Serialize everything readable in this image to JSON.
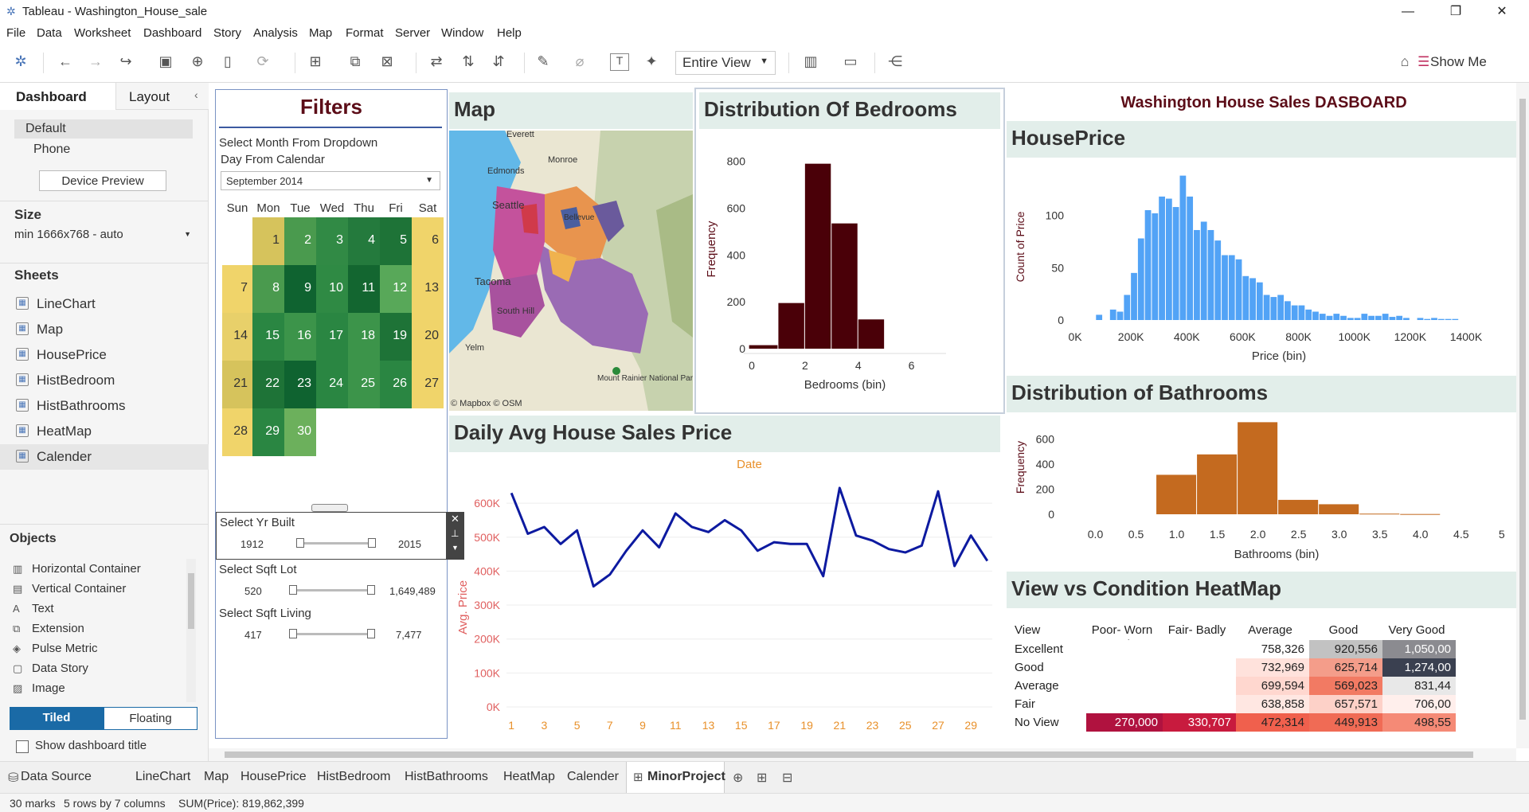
{
  "window": {
    "title": "Tableau - Washington_House_sale",
    "min": "—",
    "restore": "❐",
    "close": "✕"
  },
  "menu": [
    "File",
    "Data",
    "Worksheet",
    "Dashboard",
    "Story",
    "Analysis",
    "Map",
    "Format",
    "Server",
    "Window",
    "Help"
  ],
  "toolbar": {
    "view_mode": "Entire View",
    "show_me": "Show Me"
  },
  "left": {
    "tab_dashboard": "Dashboard",
    "tab_layout": "Layout",
    "device_default": "Default",
    "device_phone": "Phone",
    "device_preview": "Device Preview",
    "size_title": "Size",
    "size_value": "min 1666x768 - auto",
    "sheets_title": "Sheets",
    "sheets": [
      "LineChart",
      "Map",
      "HousePrice",
      "HistBedroom",
      "HistBathrooms",
      "HeatMap",
      "Calender"
    ],
    "objects_title": "Objects",
    "objects": [
      "Horizontal Container",
      "Vertical Container",
      "Text",
      "Extension",
      "Pulse Metric",
      "Data Story",
      "Image"
    ],
    "object_icons": [
      "▥",
      "▤",
      "A",
      "⧉",
      "◈",
      "▢",
      "▨"
    ],
    "tiled": "Tiled",
    "floating": "Floating",
    "show_title": "Show dashboard title"
  },
  "filters": {
    "title": "Filters",
    "instruction_1": "Select Month From Dropdown",
    "instruction_2": "Day From Calendar",
    "month_value": "September 2014",
    "weekdays": [
      "Sun",
      "Mon",
      "Tue",
      "Wed",
      "Thu",
      "Fri",
      "Sat"
    ],
    "yr_built": {
      "label": "Select Yr Built",
      "min": "1912",
      "max": "2015"
    },
    "sqft_lot": {
      "label": "Select Sqft Lot",
      "min": "520",
      "max": "1,649,489"
    },
    "sqft_living": {
      "label": "Select Sqft Living",
      "min": "417",
      "max": "7,477"
    }
  },
  "map": {
    "title": "Map",
    "attribution": "© Mapbox © OSM",
    "places": [
      "Everett",
      "Monroe",
      "Edmonds",
      "Seattle",
      "Bellevue",
      "Tacoma",
      "South Hill",
      "Yelm",
      "Mount Rainier National Park"
    ]
  },
  "dashboard_title": "Washington House Sales DASBOARD",
  "panels": {
    "bedrooms_title": "Distribution Of Bedrooms",
    "houseprice_title": "HousePrice",
    "bathrooms_title": "Distribution of Bathrooms",
    "daily_title": "Daily Avg House Sales Price",
    "heatmap_title": "View vs Condition HeatMap"
  },
  "chart_data": [
    {
      "type": "bar",
      "name": "Distribution Of Bedrooms",
      "xlabel": "Bedrooms (bin)",
      "ylabel": "Frequency",
      "x_bins": [
        0.5,
        2.0,
        3.0,
        4.0,
        5.0
      ],
      "values": [
        15,
        195,
        790,
        535,
        125
      ],
      "xlim": [
        0,
        7
      ],
      "ylim": [
        0,
        850
      ],
      "xticks": [
        "0",
        "2",
        "4",
        "6"
      ],
      "yticks": [
        "0",
        "200",
        "400",
        "600",
        "800"
      ],
      "color": "#4a0008"
    },
    {
      "type": "bar",
      "name": "HousePrice",
      "xlabel": "Price (bin)",
      "ylabel": "Count of Price",
      "bin_start_k": 75,
      "bin_width_k": 25,
      "values": [
        5,
        0,
        10,
        8,
        24,
        45,
        78,
        105,
        102,
        118,
        116,
        108,
        138,
        118,
        86,
        94,
        86,
        76,
        62,
        62,
        58,
        42,
        40,
        36,
        24,
        22,
        24,
        18,
        14,
        14,
        10,
        8,
        6,
        4,
        6,
        4,
        2,
        2,
        6,
        4,
        4,
        6,
        3,
        4,
        2,
        0,
        2,
        1,
        2,
        1,
        1,
        1
      ],
      "xlim_k": [
        0,
        1460
      ],
      "ylim": [
        0,
        140
      ],
      "xticks": [
        "0K",
        "200K",
        "400K",
        "600K",
        "800K",
        "1000K",
        "1200K",
        "1400K"
      ],
      "yticks": [
        "0",
        "50",
        "100"
      ],
      "color": "#52a3f6"
    },
    {
      "type": "bar",
      "name": "Distribution of Bathrooms",
      "xlabel": "Bathrooms (bin)",
      "ylabel": "Frequency",
      "bin_start": 0.75,
      "bin_width": 0.5,
      "values": [
        315,
        478,
        735,
        115,
        80,
        5,
        2
      ],
      "xlim": [
        -0.25,
        5.1
      ],
      "ylim": [
        0,
        750
      ],
      "xticks": [
        "0.0",
        "0.5",
        "1.0",
        "1.5",
        "2.0",
        "2.5",
        "3.0",
        "3.5",
        "4.0",
        "4.5",
        "5"
      ],
      "yticks": [
        "0",
        "200",
        "400",
        "600"
      ],
      "color": "#c46a1f"
    },
    {
      "type": "line",
      "name": "Daily Avg House Sales Price",
      "xlabel": "Date",
      "ylabel": "Avg. Price",
      "x": [
        1,
        2,
        3,
        4,
        5,
        6,
        7,
        8,
        9,
        10,
        11,
        12,
        13,
        14,
        15,
        16,
        17,
        18,
        19,
        20,
        21,
        22,
        23,
        24,
        25,
        26,
        27,
        28,
        29,
        30
      ],
      "y": [
        630000,
        510000,
        530000,
        480000,
        520000,
        355000,
        390000,
        460000,
        520000,
        470000,
        570000,
        530000,
        515000,
        550000,
        520000,
        460000,
        485000,
        480000,
        480000,
        385000,
        645000,
        505000,
        490000,
        465000,
        455000,
        475000,
        635000,
        415000,
        505000,
        430000
      ],
      "xlim": [
        0.7,
        30.3
      ],
      "ylim": [
        0,
        680000
      ],
      "xticks": [
        "1",
        "3",
        "5",
        "7",
        "9",
        "11",
        "13",
        "15",
        "17",
        "19",
        "21",
        "23",
        "25",
        "27",
        "29"
      ],
      "yticks": [
        "0K",
        "100K",
        "200K",
        "300K",
        "400K",
        "500K",
        "600K"
      ],
      "color": "#0d1aa0"
    },
    {
      "type": "heatmap",
      "name": "View vs Condition HeatMap",
      "corner": "View",
      "columns": [
        "Poor- Worn out",
        "Fair- Badly wo..",
        "Average",
        "Good",
        "Very Good"
      ],
      "rows": [
        "Excellent",
        "Good",
        "Average",
        "Fair",
        "No View"
      ],
      "cells": [
        [
          "",
          "",
          "758,326",
          "920,556",
          "1,050,00"
        ],
        [
          "",
          "",
          "732,969",
          "625,714",
          "1,274,00"
        ],
        [
          "",
          "",
          "699,594",
          "569,023",
          "831,44"
        ],
        [
          "",
          "",
          "638,858",
          "657,571",
          "706,00"
        ],
        [
          "270,000",
          "330,707",
          "472,314",
          "449,913",
          "498,55"
        ]
      ],
      "colors": [
        [
          "#ffffff",
          "#ffffff",
          "#ffffff",
          "#c2c2c2",
          "#8b8b90"
        ],
        [
          "#ffffff",
          "#ffffff",
          "#ffe2dc",
          "#f49d8a",
          "#3a4050"
        ],
        [
          "#ffffff",
          "#ffffff",
          "#ffd7cf",
          "#f27a63",
          "#e8e8e8"
        ],
        [
          "#ffffff",
          "#ffffff",
          "#ffe7e2",
          "#fdd1c8",
          "#ffefec"
        ],
        [
          "#b0123f",
          "#c81b3e",
          "#f0604d",
          "#f06b55",
          "#f58a76"
        ]
      ]
    },
    {
      "type": "table",
      "name": "Calendar September 2014",
      "days": [
        1,
        2,
        3,
        4,
        5,
        6,
        7,
        8,
        9,
        10,
        11,
        12,
        13,
        14,
        15,
        16,
        17,
        18,
        19,
        20,
        21,
        22,
        23,
        24,
        25,
        26,
        27,
        28,
        29,
        30
      ],
      "colors": [
        "#d6c35c",
        "#4a9a4e",
        "#318a45",
        "#247a3d",
        "#1e7337",
        "#f0d46a",
        "#f0d46a",
        "#4a9a4e",
        "#0f6330",
        "#2f8a44",
        "#136630",
        "#58a859",
        "#f0d46a",
        "#e8d06a",
        "#2a8642",
        "#3c944a",
        "#2a8642",
        "#3c944a",
        "#1e7337",
        "#f0d46a",
        "#d6c35c",
        "#1e7337",
        "#0f6330",
        "#2a8642",
        "#3c944a",
        "#2a8642",
        "#f0d46a",
        "#f0d46a",
        "#2a8642",
        "#6cb05c"
      ]
    }
  ],
  "bottom": {
    "data_source": "Data Source",
    "tabs": [
      "LineChart",
      "Map",
      "HousePrice",
      "HistBedroom",
      "HistBathrooms",
      "HeatMap",
      "Calender",
      "MinorProject"
    ]
  },
  "status": {
    "marks": "30 marks",
    "rows": "5 rows by 7 columns",
    "sum": "SUM(Price): 819,862,399"
  }
}
